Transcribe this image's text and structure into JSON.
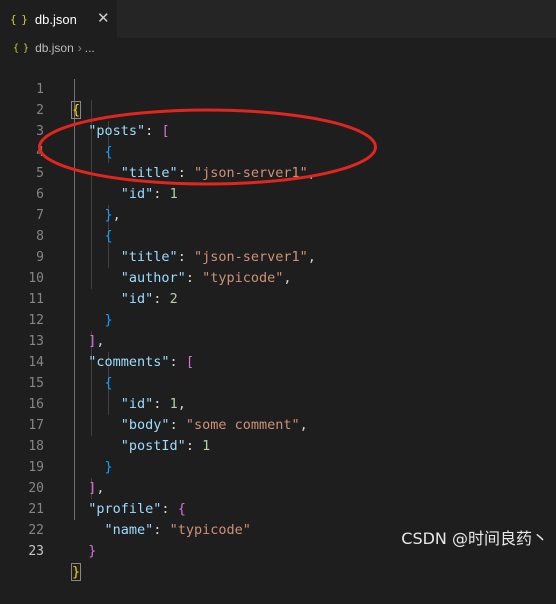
{
  "tab": {
    "icon": "json-braces-icon",
    "icon_text": "{ }",
    "filename": "db.json",
    "close": "✕"
  },
  "breadcrumb": {
    "icon_text": "{ }",
    "file": "db.json",
    "separator": "›",
    "more": "..."
  },
  "editor": {
    "active_line": 23,
    "lines": [
      {
        "n": "1"
      },
      {
        "n": "2"
      },
      {
        "n": "3"
      },
      {
        "n": "4"
      },
      {
        "n": "5"
      },
      {
        "n": "6"
      },
      {
        "n": "7"
      },
      {
        "n": "8"
      },
      {
        "n": "9"
      },
      {
        "n": "10"
      },
      {
        "n": "11"
      },
      {
        "n": "12"
      },
      {
        "n": "13"
      },
      {
        "n": "14"
      },
      {
        "n": "15"
      },
      {
        "n": "16"
      },
      {
        "n": "17"
      },
      {
        "n": "18"
      },
      {
        "n": "19"
      },
      {
        "n": "20"
      },
      {
        "n": "21"
      },
      {
        "n": "22"
      },
      {
        "n": "23"
      }
    ],
    "tokens": {
      "l2_key": "\"posts\"",
      "l4_key": "\"title\"",
      "l4_val": "\"json-server1\"",
      "l5_key": "\"id\"",
      "l5_val": "1",
      "l8_key": "\"title\"",
      "l8_val": "\"json-server1\"",
      "l9_key": "\"author\"",
      "l9_val": "\"typicode\"",
      "l10_key": "\"id\"",
      "l10_val": "2",
      "l13_key": "\"comments\"",
      "l15_key": "\"id\"",
      "l15_val": "1",
      "l16_key": "\"body\"",
      "l16_val": "\"some comment\"",
      "l17_key": "\"postId\"",
      "l17_val": "1",
      "l20_key": "\"profile\"",
      "l21_key": "\"name\"",
      "l21_val": "\"typicode\""
    }
  },
  "annotation": {
    "shape": "ellipse",
    "color": "#e0261f"
  },
  "watermark": "CSDN @时间良药丶",
  "colors": {
    "background": "#1e1e1e",
    "key": "#9cdcfe",
    "string": "#ce9178",
    "number": "#b5cea8",
    "bracket_level1": "#ffd700",
    "bracket_level2": "#da70d6",
    "bracket_level3": "#179fff"
  }
}
